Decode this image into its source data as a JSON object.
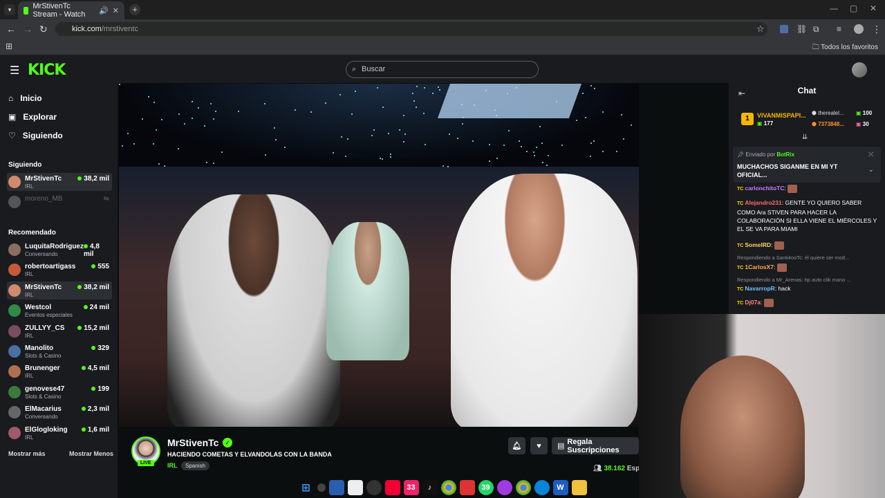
{
  "browser": {
    "tab_title": "MrStivenTc Stream - Watch",
    "tab_close": "✕",
    "new_tab": "+",
    "url_domain": "kick.com",
    "url_path": "/mrstiventc",
    "bookmarks_label": "Todos los favoritos"
  },
  "site": {
    "logo": "KICK",
    "search_placeholder": "Buscar"
  },
  "sidebar": {
    "nav": [
      "Inicio",
      "Explorar",
      "Siguiendo"
    ],
    "following_title": "Siguiendo",
    "following": [
      {
        "name": "MrStivenTc",
        "category": "IRL",
        "viewers": "38,2 mil",
        "live": true,
        "color": "#d08b6c"
      },
      {
        "name": "moreno_MB",
        "category": "",
        "viewers": "",
        "live": false,
        "color": "#555555"
      }
    ],
    "recommended_title": "Recomendado",
    "recommended": [
      {
        "name": "LuquitaRodriguez",
        "category": "Conversando",
        "viewers": "4,8 mil",
        "color": "#8a6f5f"
      },
      {
        "name": "robertoartigass",
        "category": "IRL",
        "viewers": "555",
        "color": "#c75a3a"
      },
      {
        "name": "MrStivenTc",
        "category": "IRL",
        "viewers": "38,2 mil",
        "color": "#d08b6c"
      },
      {
        "name": "Westcol",
        "category": "Eventos especiales",
        "viewers": "24 mil",
        "color": "#2f8a4a"
      },
      {
        "name": "ZULLYY_CS",
        "category": "IRL",
        "viewers": "15,2 mil",
        "color": "#7a4d5d"
      },
      {
        "name": "Manolito",
        "category": "Slots & Casino",
        "viewers": "329",
        "color": "#4a6fa5"
      },
      {
        "name": "Brunenger",
        "category": "IRL",
        "viewers": "4,5 mil",
        "color": "#b07050"
      },
      {
        "name": "genovese47",
        "category": "Slots & Casino",
        "viewers": "199",
        "color": "#3c7a3c"
      },
      {
        "name": "ElMacarius",
        "category": "Conversando",
        "viewers": "2,3 mil",
        "color": "#666666"
      },
      {
        "name": "ElGlogloking",
        "category": "IRL",
        "viewers": "1,6 mil",
        "color": "#a05a6a"
      }
    ],
    "show_more": "Mostrar más",
    "show_less": "Mostrar Menos"
  },
  "stream": {
    "channel": "MrStivenTc",
    "title": "HACIENDO COMETAS Y ELVANDOLAS CON LA BANDA",
    "category": "IRL",
    "language": "Spanish",
    "live_badge": "LIVE",
    "subscribe_label": "Regala Suscripciones",
    "viewers": "38.162",
    "viewers_suffix": "Esp"
  },
  "chat": {
    "title": "Chat",
    "leaderboard": [
      {
        "rank": "1",
        "name": "VIVANMISPAPI...",
        "value": "177"
      },
      {
        "name": "therealel...",
        "value": "100"
      },
      {
        "name": "7373848...",
        "value": "30"
      }
    ],
    "pinned_source_prefix": "Enviado por",
    "pinned_source_user": "BotRix",
    "pinned_message": "MUCHACHOS SIGANME EN MI YT OFICIAL...",
    "messages": [
      {
        "user": "carlonchitoTC",
        "text": "",
        "color": "#c77dff"
      },
      {
        "user": "Alejandro231",
        "text": "GENTE YO QUIERO SABER COMO Ara STIVEN PARA HACER LA COLABORACIÓN SI ELLA VIENE EL MIÉRCOLES Y EL SE VA PARA MIAMI",
        "color": "#ff6b6b"
      },
      {
        "user": "SomelRD",
        "text": "",
        "color": "#ffd166"
      },
      {
        "reply": "Respondiendo a Santi4ooTc: él quiere ser mod..."
      },
      {
        "user": "1CarlosX7",
        "text": "",
        "color": "#ffa94d"
      },
      {
        "reply": "Respondiendo a Mr_Arenas: hp auto clik mano ..."
      },
      {
        "user": "NavarropR",
        "text": "hack",
        "color": "#74c0fc"
      },
      {
        "user": "Dj07a",
        "text": "",
        "color": "#ff8787"
      }
    ]
  },
  "taskbar": {
    "badge_count_1": "39",
    "badge_count_2": "33"
  }
}
